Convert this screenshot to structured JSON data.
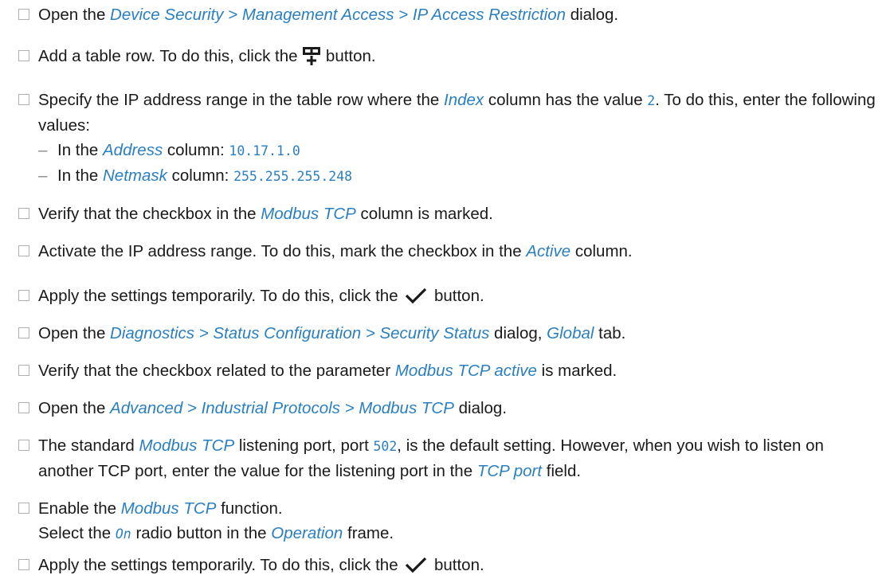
{
  "steps": [
    {
      "t1": "Open the ",
      "i1": "Device Security > Management Access > IP Access Restriction",
      "t2": " dialog."
    },
    {
      "t1": "Add a table row. To do this, click the ",
      "icon": "add-table-row-icon",
      "t2": " button."
    },
    {
      "t1": "Specify the IP address range in the table row where the ",
      "i1": "Index",
      "t2": " column has the value ",
      "c1": "2",
      "t3": ". To do this, enter the following values:",
      "sub": [
        {
          "dash": "–",
          "t1": "In the ",
          "i1": "Address",
          "t2": " column: ",
          "c1": "10.17.1.0"
        },
        {
          "dash": "–",
          "t1": "In the ",
          "i1": "Netmask",
          "t2": " column: ",
          "c1": "255.255.255.248"
        }
      ]
    },
    {
      "t1": "Verify that the checkbox in the ",
      "i1": "Modbus TCP",
      "t2": " column is marked."
    },
    {
      "t1": "Activate the IP address range. To do this, mark the checkbox in the ",
      "i1": "Active",
      "t2": " column."
    },
    {
      "t1": "Apply the settings temporarily. To do this, click the ",
      "icon": "checkmark-icon",
      "t2": " button."
    },
    {
      "t1": "Open the ",
      "i1": "Diagnostics > Status Configuration > Security Status",
      "t2": " dialog, ",
      "i2": "Global",
      "t3": " tab."
    },
    {
      "t1": "Verify that the checkbox related to the parameter ",
      "i1": "Modbus TCP active",
      "t2": " is marked."
    },
    {
      "t1": "Open the ",
      "i1": "Advanced > Industrial Protocols > Modbus TCP",
      "t2": " dialog."
    },
    {
      "t1": "The standard ",
      "i1": "Modbus TCP",
      "t2": " listening port, port ",
      "c1": "502",
      "t3": ", is the default setting. However, when you wish to listen on another TCP port, enter the value for the listening port in the ",
      "i2": "TCP port",
      "t4": " field."
    },
    {
      "t1": "Enable the ",
      "i1": "Modbus TCP",
      "t2": " function.",
      "line2a": "Select the ",
      "c1": "On",
      "line2b": " radio button in the ",
      "i2": "Operation",
      "line2c": " frame."
    },
    {
      "t1": "Apply the settings temporarily. To do this, click the ",
      "icon": "checkmark-icon",
      "t2": " button."
    }
  ]
}
